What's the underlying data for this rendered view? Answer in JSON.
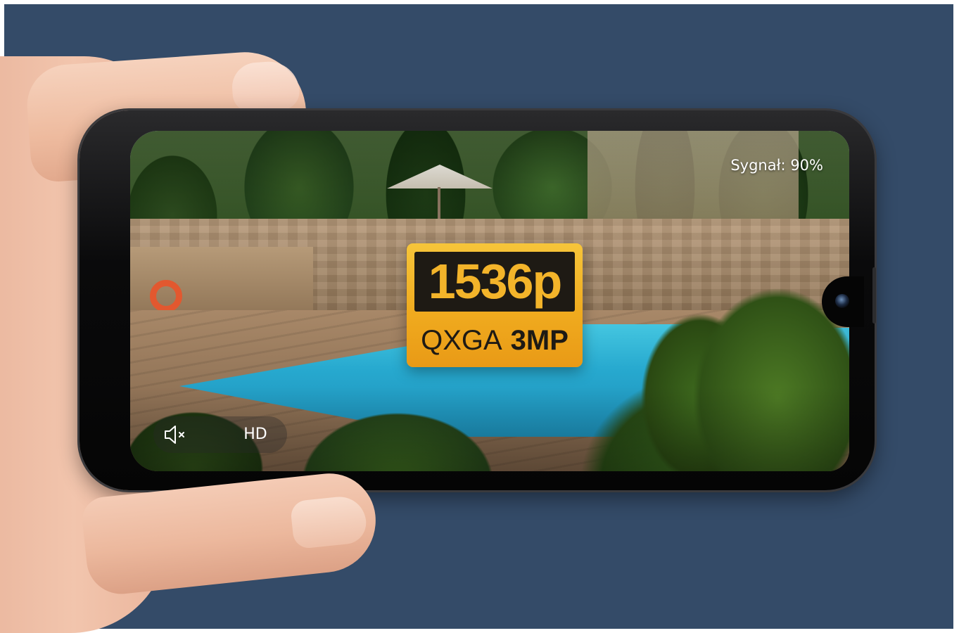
{
  "colors": {
    "background": "#344b68",
    "badge_gold": "#f0ab1f",
    "badge_dark": "#1e1a14",
    "overlay_text": "#ffffff"
  },
  "stream": {
    "signal_text": "Sygnał: 90%"
  },
  "controls": {
    "mute_icon": "speaker-muted-icon",
    "quality_label": "HD"
  },
  "badge": {
    "resolution": "1536p",
    "format": "QXGA",
    "megapixels": "3MP"
  }
}
